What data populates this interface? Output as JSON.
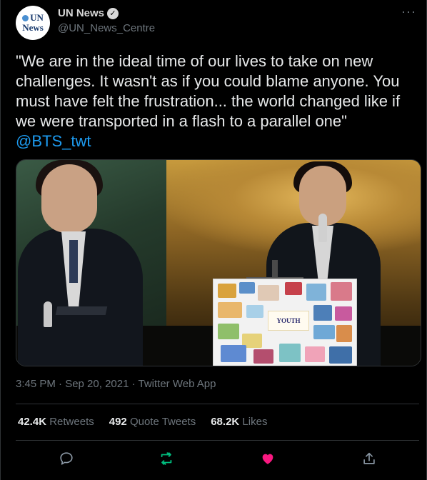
{
  "author": {
    "avatar_line1": "UN",
    "avatar_line2": "News",
    "display_name": "UN News",
    "verified_mark": "✓",
    "handle": "@UN_News_Centre"
  },
  "tweet": {
    "text": "\"We are in the ideal time of our lives to take on new challenges. It wasn't as if you could blame anyone. You must have felt the frustration... the world changed like if we were transported in a flash to a parallel one\"",
    "mention": "@BTS_twt",
    "timestamp": "3:45 PM · Sep 20, 2021 · Twitter Web App",
    "more_label": "···"
  },
  "media": {
    "board_label": "YOUTH"
  },
  "stats": {
    "retweets_count": "42.4K",
    "retweets_label": "Retweets",
    "quotes_count": "492",
    "quotes_label": "Quote Tweets",
    "likes_count": "68.2K",
    "likes_label": "Likes"
  },
  "actions": [
    {
      "icon": "reply-icon"
    },
    {
      "icon": "retweet-icon",
      "color": "#00ba7c"
    },
    {
      "icon": "like-icon",
      "color": "#f91880"
    },
    {
      "icon": "share-icon"
    }
  ],
  "colors": {
    "background": "#000000",
    "link": "#1d9bf0",
    "muted": "#6e767d",
    "retweet_active": "#00ba7c",
    "like_active": "#f91880"
  }
}
